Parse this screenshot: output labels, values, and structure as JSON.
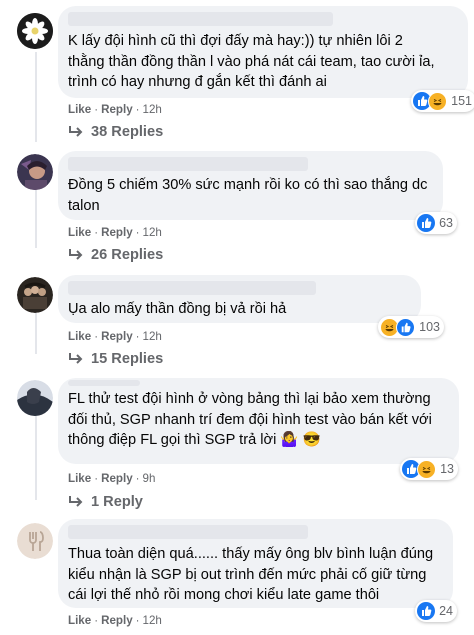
{
  "comments": [
    {
      "text": "K lấy đội hình cũ thì đợi đấy mà hay:)) tự nhiên lôi 2\nthằng thần đồng thần l vào phá nát cái team, tao cười ỉa,\ntrình có hay nhưng đ gắn kết thì đánh ai",
      "like": "Like",
      "reply": "Reply",
      "time": "12h",
      "reaction_count": "151",
      "replies": "38 Replies"
    },
    {
      "text": "Đồng 5 chiếm 30% sức mạnh rồi ko có thì sao thắng dc\ntalon",
      "like": "Like",
      "reply": "Reply",
      "time": "12h",
      "reaction_count": "63",
      "replies": "26 Replies"
    },
    {
      "text": "Ụa alo mấy thần đồng bị vả rồi hả",
      "like": "Like",
      "reply": "Reply",
      "time": "12h",
      "reaction_count": "103",
      "replies": "15 Replies"
    },
    {
      "text": "FL thử test đội hình ở vòng bảng thì lại bảo xem thường\nđối thủ, SGP nhanh trí đem đội hình test vào bán kết với\nthông điệp FL gọi thì SGP trả lời 🤷‍♀️ 😎",
      "like": "Like",
      "reply": "Reply",
      "time": "9h",
      "reaction_count": "13",
      "replies": "1 Reply"
    },
    {
      "text": "Thua toàn diện quá...... thấy mấy ông blv bình luận đúng\nkiểu nhận là SGP bị out trình đến mức phải cố giữ từng\ncái lợi thế nhỏ rồi mong chơi kiểu late game thôi",
      "like": "Like",
      "reply": "Reply",
      "time": "12h",
      "reaction_count": "24",
      "replies": ""
    }
  ],
  "colors": {
    "like_blue": "#1877f2",
    "haha_yellow": "#f7b125",
    "bubble": "#f0f2f5",
    "meta": "#65676b"
  }
}
